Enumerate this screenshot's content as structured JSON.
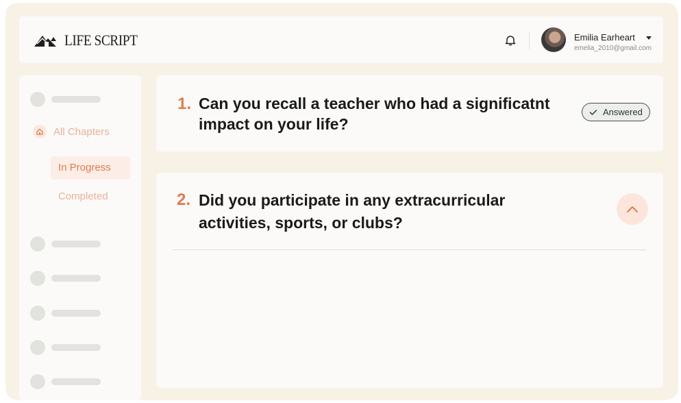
{
  "header": {
    "brand": "LIFE SCRIPT",
    "user": {
      "name": "Emilia Earheart",
      "email": "emelia_2010@gmail.com"
    },
    "icons": {
      "bell": "bell-icon",
      "caret": "caret-down-icon"
    }
  },
  "sidebar": {
    "nav": {
      "all_chapters": "All Chapters",
      "in_progress": "In Progress",
      "completed": "Completed"
    },
    "icons": {
      "home": "home-icon"
    }
  },
  "questions": [
    {
      "number": "1.",
      "line1": "Can you recall a teacher who had a significatnt",
      "line2": "impact on your life?",
      "status": "Answered"
    },
    {
      "number": "2.",
      "line1": "Did you participate in any extracurricular",
      "line2": "activities, sports, or clubs?"
    }
  ],
  "colors": {
    "accent": "#e07b4f",
    "accent_soft": "#fceee6",
    "frame": "#f8f2e6",
    "card": "#fbfaf8"
  }
}
